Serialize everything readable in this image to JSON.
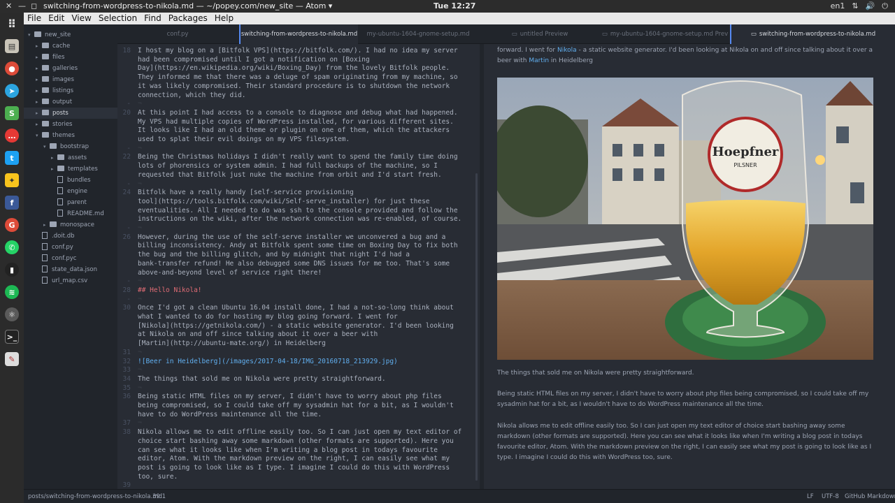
{
  "window": {
    "title": "switching-from-wordpress-to-nikola.md — ~/popey.com/new_site — Atom ▾",
    "clock": "Tue 12:27",
    "tray": [
      "en1",
      "⇅",
      "🔊",
      "⏻"
    ]
  },
  "menu": [
    "File",
    "Edit",
    "View",
    "Selection",
    "Find",
    "Packages",
    "Help"
  ],
  "tree": [
    {
      "label": "new_site",
      "type": "folder",
      "depth": 0,
      "open": true
    },
    {
      "label": "cache",
      "type": "folder",
      "depth": 1,
      "open": false
    },
    {
      "label": "files",
      "type": "folder",
      "depth": 1,
      "open": false
    },
    {
      "label": "galleries",
      "type": "folder",
      "depth": 1,
      "open": false
    },
    {
      "label": "images",
      "type": "folder",
      "depth": 1,
      "open": false
    },
    {
      "label": "listings",
      "type": "folder",
      "depth": 1,
      "open": false
    },
    {
      "label": "output",
      "type": "folder",
      "depth": 1,
      "open": false
    },
    {
      "label": "posts",
      "type": "folder",
      "depth": 1,
      "open": false,
      "selected": true
    },
    {
      "label": "stories",
      "type": "folder",
      "depth": 1,
      "open": false
    },
    {
      "label": "themes",
      "type": "folder",
      "depth": 1,
      "open": true
    },
    {
      "label": "bootstrap",
      "type": "folder",
      "depth": 2,
      "open": true
    },
    {
      "label": "assets",
      "type": "folder",
      "depth": 3,
      "open": false
    },
    {
      "label": "templates",
      "type": "folder",
      "depth": 3,
      "open": false
    },
    {
      "label": "bundles",
      "type": "file",
      "depth": 3
    },
    {
      "label": "engine",
      "type": "file",
      "depth": 3
    },
    {
      "label": "parent",
      "type": "file",
      "depth": 3
    },
    {
      "label": "README.md",
      "type": "file",
      "depth": 3
    },
    {
      "label": "monospace",
      "type": "folder",
      "depth": 2,
      "open": false
    },
    {
      "label": ".doit.db",
      "type": "file",
      "depth": 1
    },
    {
      "label": "conf.py",
      "type": "file",
      "depth": 1
    },
    {
      "label": "conf.pyc",
      "type": "file",
      "depth": 1
    },
    {
      "label": "state_data.json",
      "type": "file",
      "depth": 1
    },
    {
      "label": "url_map.csv",
      "type": "file",
      "depth": 1
    }
  ],
  "tabs": [
    {
      "label": "conf.py",
      "active": false,
      "icon": ""
    },
    {
      "label": "switching-from-wordpress-to-nikola.md",
      "active": true,
      "icon": ""
    },
    {
      "label": "my-ubuntu-1604-gnome-setup.md",
      "active": false,
      "icon": ""
    },
    {
      "label": "untitled Preview",
      "active": false,
      "icon": "▭"
    },
    {
      "label": "my-ubuntu-1604-gnome-setup.md Prev",
      "active": false,
      "icon": "▭"
    },
    {
      "label": "switching-from-wordpress-to-nikola.md",
      "active": true,
      "icon": "▭"
    }
  ],
  "gutter": [
    {
      "n": "18",
      "row": 0
    },
    {
      "n": "-",
      "row": 6
    },
    {
      "n": "20",
      "row": 7
    },
    {
      "n": "-",
      "row": 11
    },
    {
      "n": "22",
      "row": 12
    },
    {
      "n": "-",
      "row": 15
    },
    {
      "n": "24",
      "row": 16
    },
    {
      "n": "-",
      "row": 20
    },
    {
      "n": "26",
      "row": 21
    },
    {
      "n": "-",
      "row": 26
    },
    {
      "n": "28",
      "row": 27
    },
    {
      "n": "-",
      "row": 28
    },
    {
      "n": "30",
      "row": 29
    },
    {
      "n": "31",
      "row": 34
    },
    {
      "n": "32",
      "row": 35
    },
    {
      "n": "33",
      "row": 36
    },
    {
      "n": "34",
      "row": 37
    },
    {
      "n": "35",
      "row": 38
    },
    {
      "n": "36",
      "row": 39
    },
    {
      "n": "37",
      "row": 42
    },
    {
      "n": "38",
      "row": 43
    },
    {
      "n": "39",
      "row": 49
    }
  ],
  "code": [
    {
      "t": "I host my blog on a [Bitfolk VPS](https://bitfolk.com/). I had no idea my server",
      "k": ""
    },
    {
      "t": "had been compromised until I got a notification on [Boxing",
      "k": ""
    },
    {
      "t": "Day](https://en.wikipedia.org/wiki/Boxing_Day) from the lovely Bitfolk people.",
      "k": ""
    },
    {
      "t": "They informed me that there was a deluge of spam originating from my machine, so",
      "k": ""
    },
    {
      "t": "it was likely compromised. Their standard procedure is to shutdown the network",
      "k": ""
    },
    {
      "t": "connection, which they did.",
      "k": ""
    },
    {
      "t": "¬",
      "k": "blank"
    },
    {
      "t": "At this point I had access to a console to diagnose and debug what had happened.",
      "k": ""
    },
    {
      "t": "My VPS had multiple copies of WordPress installed, for various different sites.",
      "k": ""
    },
    {
      "t": "It looks like I had an old theme or plugin on one of them, which the attackers",
      "k": ""
    },
    {
      "t": "used to splat their evil doings on my VPS filesystem.",
      "k": ""
    },
    {
      "t": "¬",
      "k": "blank"
    },
    {
      "t": "Being the Christmas holidays I didn't really want to spend the family time doing",
      "k": ""
    },
    {
      "t": "lots of phorensics or system admin. I had full backups of the machine, so I",
      "k": ""
    },
    {
      "t": "requested that Bitfolk just nuke the machine from orbit and I'd start fresh.",
      "k": ""
    },
    {
      "t": "¬",
      "k": "blank"
    },
    {
      "t": "Bitfolk have a really handy [self-service provisioning",
      "k": ""
    },
    {
      "t": "tool](https://tools.bitfolk.com/wiki/Self-serve_installer) for just these",
      "k": ""
    },
    {
      "t": "eventualities. All I needed to do was ssh to the console provided and follow the",
      "k": ""
    },
    {
      "t": "instructions on the wiki, after the network connection was re-enabled, of course.",
      "k": ""
    },
    {
      "t": "¬",
      "k": "blank"
    },
    {
      "t": "However, during the use of the self-serve installer we unconvered a bug and a",
      "k": ""
    },
    {
      "t": "billing inconsistency. Andy at Bitfolk spent some time on Boxing Day to fix both",
      "k": ""
    },
    {
      "t": "the bug and the billing glitch, and by midnight that night I'd had a",
      "k": ""
    },
    {
      "t": "bank-transfer refund! He also debugged some DNS issues for me too. That's some",
      "k": ""
    },
    {
      "t": "above-and-beyond level of service right there!",
      "k": ""
    },
    {
      "t": "¬",
      "k": "blank"
    },
    {
      "t": "## Hello Nikola!",
      "k": "head"
    },
    {
      "t": "¬",
      "k": "blank"
    },
    {
      "t": "Once I'd got a clean Ubuntu 16.04 install done, I had a not-so-long think about",
      "k": ""
    },
    {
      "t": "what I wanted to do for hosting my blog going forward. I went for",
      "k": ""
    },
    {
      "t": "[Nikola](https://getnikola.com/) - a static website generator. I'd been looking",
      "k": ""
    },
    {
      "t": "at Nikola on and off since talking about it over a beer with",
      "k": ""
    },
    {
      "t": "[Martin](http://ubuntu-mate.org/) in Heidelberg",
      "k": ""
    },
    {
      "t": "¬",
      "k": "blank"
    },
    {
      "t": "![Beer in Heidelberg](/images/2017-04-18/IMG_20160718_213929.jpg)",
      "k": "link"
    },
    {
      "t": "¬",
      "k": "blank"
    },
    {
      "t": "The things that sold me on Nikola were pretty straightforward.",
      "k": ""
    },
    {
      "t": "¬",
      "k": "blank"
    },
    {
      "t": "Being static HTML files on my server, I didn't have to worry about php files",
      "k": ""
    },
    {
      "t": "being compromised, so I could take off my sysadmin hat for a bit, as I wouldn't",
      "k": ""
    },
    {
      "t": "have to do WordPress maintenance all the time.",
      "k": ""
    },
    {
      "t": "¬",
      "k": "blank"
    },
    {
      "t": "Nikola allows me to edit offline easily too. So I can just open my text editor of",
      "k": ""
    },
    {
      "t": "choice start bashing away some markdown (other formats are supported). Here you",
      "k": ""
    },
    {
      "t": "can see what it looks like when I'm writing a blog post in todays favourite",
      "k": ""
    },
    {
      "t": "editor, Atom. With the markdown preview on the right, I can easily see what my",
      "k": ""
    },
    {
      "t": "post is going to look like as I type. I imagine I could do this with WordPress",
      "k": ""
    },
    {
      "t": "too, sure.",
      "k": ""
    },
    {
      "t": "",
      "k": "cur"
    }
  ],
  "preview": {
    "p1_a": "forward. I went for ",
    "p1_link1": "Nikola",
    "p1_b": " - a static website generator. I'd been looking at Nikola on and off since talking about it over a beer with ",
    "p1_link2": "Martin",
    "p1_c": " in Heidelberg",
    "coaster_brand": "Hoepfner",
    "coaster_sub": "PILSNER",
    "p2": "The things that sold me on Nikola were pretty straightforward.",
    "p3": "Being static HTML files on my server, I didn't have to worry about php files being compromised, so I could take off my sysadmin hat for a bit, as I wouldn't have to do WordPress maintenance all the time.",
    "p4": "Nikola allows me to edit offline easily too. So I can just open my text editor of choice start bashing away some markdown (other formats are supported). Here you can see what it looks like when I'm writing a blog post in todays favourite editor, Atom. With the markdown preview on the right, I can easily see what my post is going to look like as I type. I imagine I could do this with WordPress too, sure."
  },
  "status": {
    "path": "posts/switching-from-wordpress-to-nikola.md",
    "cursor": "39:1",
    "eol": "LF",
    "encoding": "UTF-8",
    "grammar": "GitHub Markdown"
  },
  "colors": {
    "accent": "#568af2",
    "link": "#61afef",
    "heading": "#e06c75",
    "text": "#abb2bf"
  }
}
